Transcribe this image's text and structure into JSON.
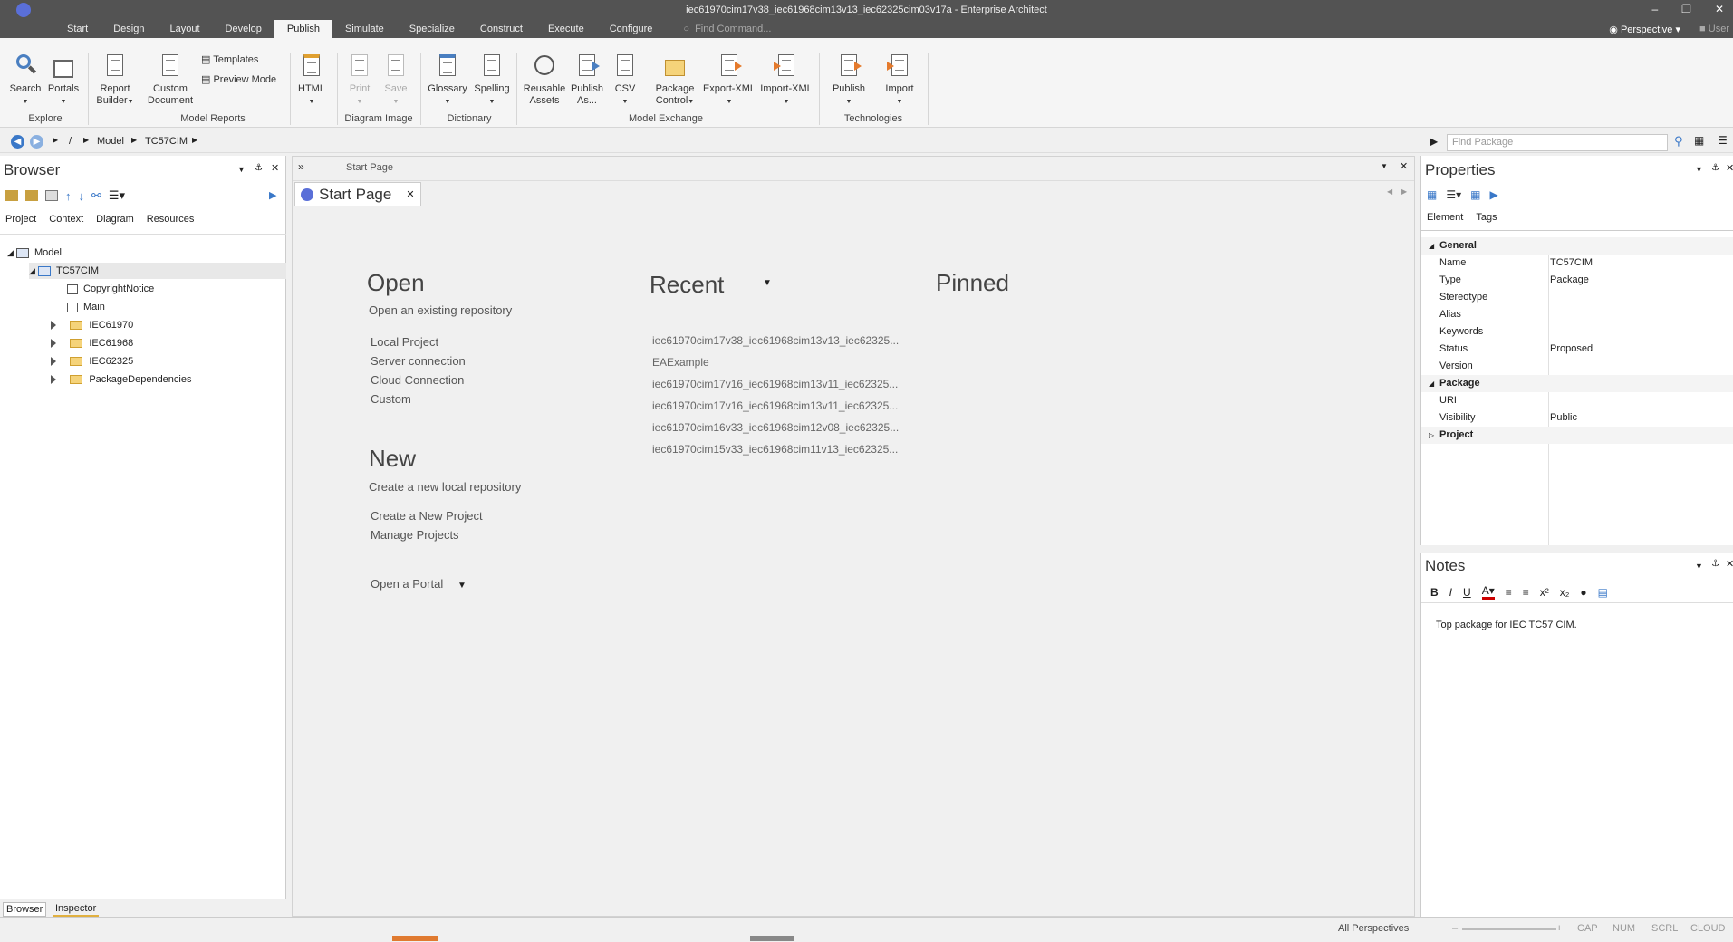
{
  "title": "iec61970cim17v38_iec61968cim13v13_iec62325cim03v17a - Enterprise Architect",
  "menu": [
    "Start",
    "Design",
    "Layout",
    "Develop",
    "Publish",
    "Simulate",
    "Specialize",
    "Construct",
    "Execute",
    "Configure"
  ],
  "find_command": "Find Command...",
  "perspective": "Perspective",
  "user": "User",
  "ribbon": {
    "search": "Search",
    "portals": "Portals",
    "report_builder": "Report Builder",
    "custom_document": "Custom Document",
    "templates": "Templates",
    "preview_mode": "Preview Mode",
    "html": "HTML",
    "print": "Print",
    "save": "Save",
    "glossary": "Glossary",
    "spelling": "Spelling",
    "reusable_assets": "Reusable Assets",
    "publish_as": "Publish As...",
    "csv": "CSV",
    "package_control": "Package Control",
    "export_xml": "Export-XML",
    "import_xml": "Import-XML",
    "publish": "Publish",
    "import": "Import",
    "groups": {
      "explore": "Explore",
      "model_reports": "Model Reports",
      "diagram_image": "Diagram Image",
      "dictionary": "Dictionary",
      "model_exchange": "Model Exchange",
      "technologies": "Technologies"
    }
  },
  "breadcrumb": [
    "/",
    "Model",
    "TC57CIM"
  ],
  "find_package": "Find Package",
  "browser": {
    "title": "Browser",
    "tabs": [
      "Project",
      "Context",
      "Diagram",
      "Resources"
    ],
    "tree": {
      "model": "Model",
      "tc57cim": "TC57CIM",
      "copyright": "CopyrightNotice",
      "main": "Main",
      "iec61970": "IEC61970",
      "iec61968": "IEC61968",
      "iec62325": "IEC62325",
      "pkgdeps": "PackageDependencies"
    },
    "bottom_tabs": [
      "Browser",
      "Inspector"
    ]
  },
  "center": {
    "breadcrumb": "Start Page",
    "tab": "Start Page",
    "open": {
      "heading": "Open",
      "sub": "Open an existing repository",
      "links": [
        "Local Project",
        "Server connection",
        "Cloud Connection",
        "Custom"
      ]
    },
    "recent": {
      "heading": "Recent",
      "items": [
        "iec61970cim17v38_iec61968cim13v13_iec62325...",
        "EAExample",
        "iec61970cim17v16_iec61968cim13v11_iec62325...",
        "iec61970cim17v16_iec61968cim13v11_iec62325...",
        "iec61970cim16v33_iec61968cim12v08_iec62325...",
        "iec61970cim15v33_iec61968cim11v13_iec62325..."
      ]
    },
    "pinned": "Pinned",
    "new": {
      "heading": "New",
      "sub": "Create a new local repository",
      "links": [
        "Create a New Project",
        "Manage Projects"
      ]
    },
    "portal": "Open a Portal"
  },
  "properties": {
    "title": "Properties",
    "tabs": [
      "Element",
      "Tags"
    ],
    "general": "General",
    "rows": [
      {
        "k": "Name",
        "v": "TC57CIM"
      },
      {
        "k": "Type",
        "v": "Package"
      },
      {
        "k": "Stereotype",
        "v": ""
      },
      {
        "k": "Alias",
        "v": ""
      },
      {
        "k": "Keywords",
        "v": ""
      },
      {
        "k": "Status",
        "v": "Proposed"
      },
      {
        "k": "Version",
        "v": ""
      }
    ],
    "package": "Package",
    "rows2": [
      {
        "k": "URI",
        "v": ""
      },
      {
        "k": "Visibility",
        "v": "Public"
      }
    ],
    "project": "Project"
  },
  "notes": {
    "title": "Notes",
    "text": "Top package for IEC TC57 CIM."
  },
  "status": {
    "perspectives": "All Perspectives",
    "cap": "CAP",
    "num": "NUM",
    "scrl": "SCRL",
    "cloud": "CLOUD"
  }
}
